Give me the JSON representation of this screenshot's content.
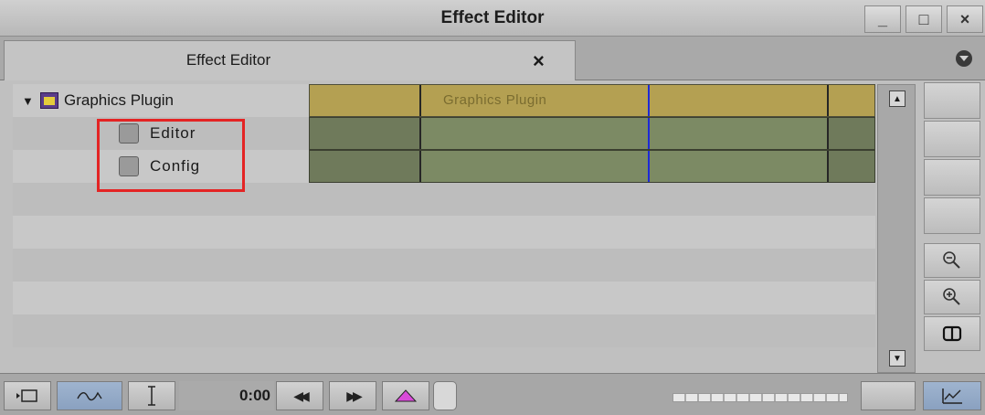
{
  "window": {
    "title": "Effect Editor",
    "controls": {
      "minimize": "_",
      "maximize": "□",
      "close": "×"
    }
  },
  "tab": {
    "label": "Effect Editor",
    "close": "×",
    "menu_icon": "chevron-circle-icon"
  },
  "tree": {
    "root": {
      "label": "Graphics Plugin",
      "icon": "plugin-icon",
      "expander": "▼"
    },
    "params": [
      {
        "label": "Editor"
      },
      {
        "label": "Config"
      }
    ]
  },
  "timeline": {
    "track_label": "Graphics Plugin"
  },
  "scroll": {
    "up": "▲",
    "down": "▼"
  },
  "side_tools": {
    "zoom_out_icon": "zoom-out-icon",
    "zoom_in_icon": "zoom-in-icon",
    "split_view_icon": "split-view-icon"
  },
  "bottom": {
    "timecode": "0:00",
    "rewind": "◀◀",
    "fast_forward": "▶▶"
  },
  "colors": {
    "header_track": "#b4a052",
    "param_track": "#7c8a64",
    "highlight_box": "#e42424",
    "position_indicator": "#1e2ad6"
  }
}
